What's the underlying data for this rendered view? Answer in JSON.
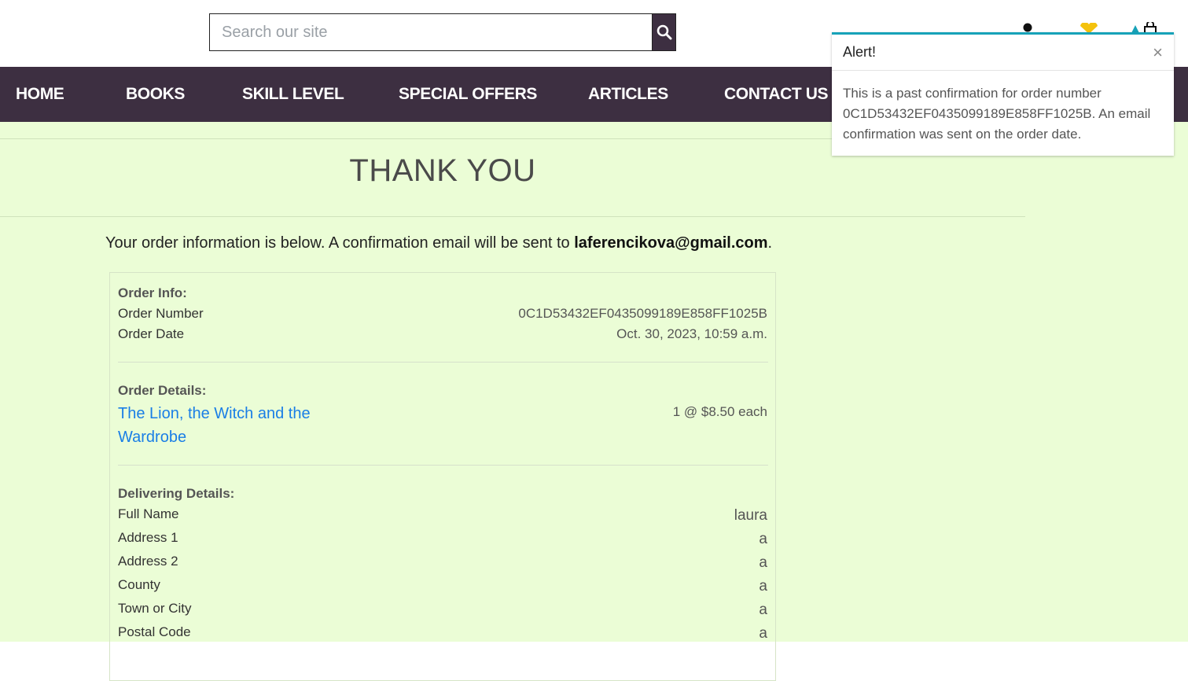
{
  "search": {
    "placeholder": "Search our site",
    "icon": "search-icon"
  },
  "colors": {
    "nav_bg": "#3d2f41",
    "main_bg": "#ebfdd6",
    "link": "#1a7ee6",
    "alert_accent": "#17a2b8",
    "heart": "#f4c20d"
  },
  "nav": {
    "items": [
      {
        "label": "HOME"
      },
      {
        "label": "BOOKS"
      },
      {
        "label": "SKILL LEVEL"
      },
      {
        "label": "SPECIAL OFFERS"
      },
      {
        "label": "ARTICLES"
      },
      {
        "label": "CONTACT US"
      }
    ]
  },
  "page": {
    "title": "THANK YOU",
    "intro_text": "Your order information is below. A confirmation email will be sent to",
    "intro_email": "laferencikova@gmail.com",
    "intro_end": "."
  },
  "order_info": {
    "heading": "Order Info:",
    "number_label": "Order Number",
    "number_value": "0C1D53432EF0435099189E858FF1025B",
    "date_label": "Order Date",
    "date_value": "Oct. 30, 2023, 10:59 a.m."
  },
  "order_details": {
    "heading": "Order Details:",
    "book_title": "The Lion, the Witch and the Wardrobe",
    "quantity": "1 @ $8.50 each"
  },
  "delivering": {
    "heading": "Delivering Details:",
    "rows": [
      {
        "label": "Full Name",
        "value": "laura"
      },
      {
        "label": "Address 1",
        "value": "a"
      },
      {
        "label": "Address 2",
        "value": "a"
      },
      {
        "label": "County",
        "value": "a"
      },
      {
        "label": "Town or City",
        "value": "a"
      },
      {
        "label": "Postal Code",
        "value": "a"
      }
    ]
  },
  "alert": {
    "title": "Alert!",
    "close": "×",
    "message": "This is a past confirmation for order number 0C1D53432EF0435099189E858FF1025B. An email confirmation was sent on the order date."
  }
}
